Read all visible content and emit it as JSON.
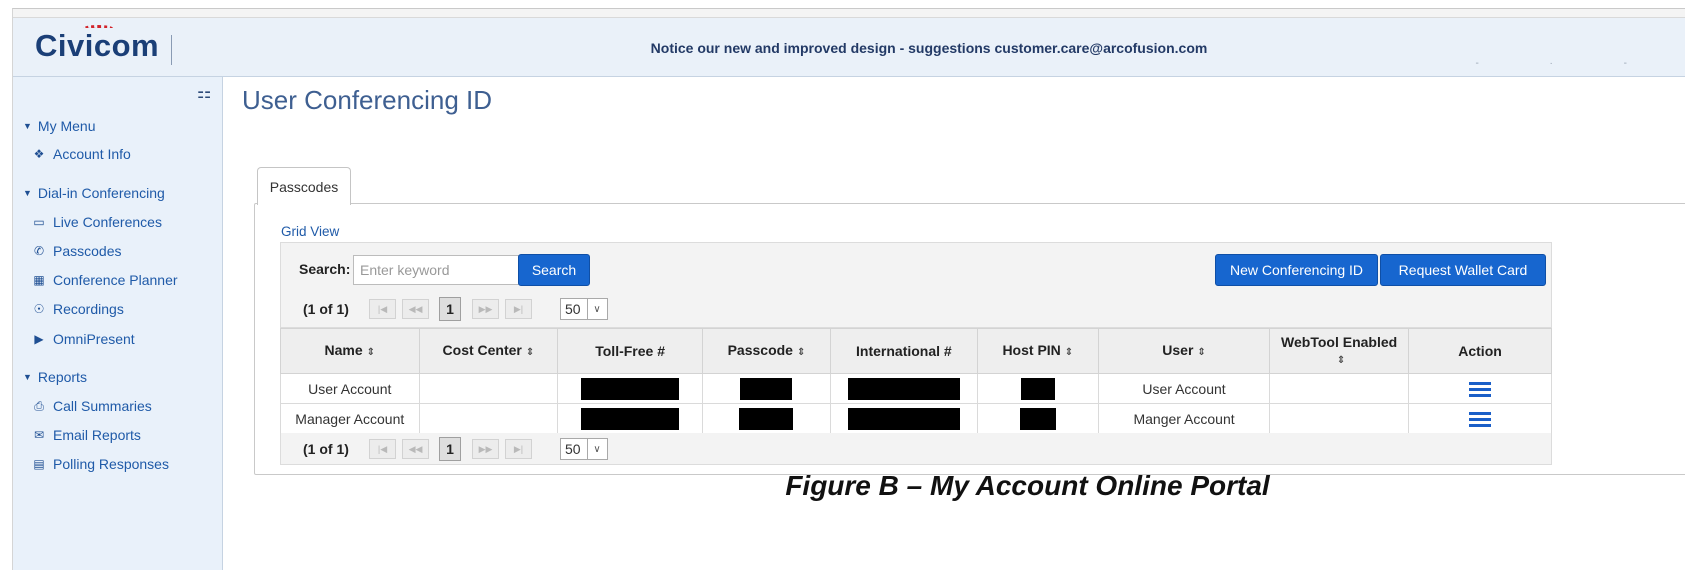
{
  "header": {
    "logo": "Civicom",
    "notice": "Notice our new and improved design - suggestions customer.care@arcofusion.com"
  },
  "sidebar": {
    "groups": [
      {
        "label": "My Menu",
        "items": [
          {
            "label": "Account Info",
            "icon": "info-circle-icon"
          }
        ]
      },
      {
        "label": "Dial-in Conferencing",
        "items": [
          {
            "label": "Live Conferences",
            "icon": "laptop-icon"
          },
          {
            "label": "Passcodes",
            "icon": "phone-icon"
          },
          {
            "label": "Conference Planner",
            "icon": "calendar-icon"
          },
          {
            "label": "Recordings",
            "icon": "headphones-icon"
          },
          {
            "label": "OmniPresent",
            "icon": "play-circle-icon"
          }
        ]
      },
      {
        "label": "Reports",
        "items": [
          {
            "label": "Call Summaries",
            "icon": "print-icon"
          },
          {
            "label": "Email Reports",
            "icon": "envelope-icon"
          },
          {
            "label": "Polling Responses",
            "icon": "bar-chart-icon"
          }
        ]
      }
    ]
  },
  "main": {
    "title": "User Conferencing ID",
    "tab": "Passcodes",
    "grid_view": "Grid View",
    "search": {
      "label": "Search:",
      "placeholder": "Enter keyword",
      "button": "Search"
    },
    "buttons": {
      "new_id": "New Conferencing ID",
      "wallet_card": "Request Wallet Card"
    },
    "pager": {
      "count": "(1 of 1)",
      "page": "1",
      "page_size": "50"
    },
    "table": {
      "columns": [
        "Name",
        "Cost Center",
        "Toll-Free #",
        "Passcode",
        "International #",
        "Host PIN",
        "User",
        "WebTool Enabled",
        "Action"
      ],
      "rows": [
        {
          "name": "User Account",
          "cost_center": "",
          "user": "User Account",
          "webtool": ""
        },
        {
          "name": "Manager Account",
          "cost_center": "",
          "user": "Manger Account",
          "webtool": ""
        }
      ]
    }
  },
  "caption": "Figure B – My Account Online Portal",
  "colors": {
    "accent": "#1766cf",
    "sidebar_bg": "#e9f1fa",
    "header_bg": "#eaf1f9",
    "link": "#1f5aa8"
  }
}
